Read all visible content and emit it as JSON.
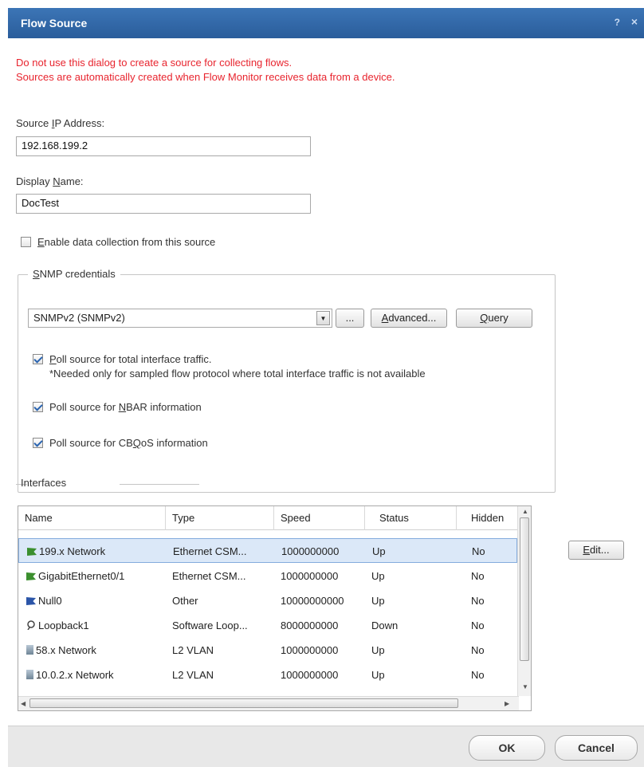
{
  "dialog": {
    "title": "Flow Source",
    "help_glyph": "?",
    "close_glyph": "×"
  },
  "warning": {
    "line1": "Do not use this dialog to create a source for collecting flows.",
    "line2": "Sources are automatically created when Flow Monitor receives data from a device."
  },
  "source_ip": {
    "label_pre": "Source ",
    "label_key": "I",
    "label_post": "P Address:",
    "value": "192.168.199.2"
  },
  "display_name": {
    "label_pre": "Display ",
    "label_key": "N",
    "label_post": "ame:",
    "value": "DocTest"
  },
  "enable_collection": {
    "key": "E",
    "rest": "nable data collection from this source",
    "checked": false
  },
  "snmp": {
    "legend_key": "S",
    "legend_rest": "NMP credentials",
    "selected": "SNMPv2 (SNMPv2)",
    "ellipsis_label": "...",
    "advanced_key": "A",
    "advanced_rest": "dvanced...",
    "query_key": "Q",
    "query_rest": "uery",
    "poll_total_key": "P",
    "poll_total_rest": "oll source for total interface traffic.",
    "poll_total_note": "*Needed only for sampled flow protocol where total interface traffic is not available",
    "poll_nbar_pre": "Poll source for ",
    "poll_nbar_key": "N",
    "poll_nbar_post": "BAR information",
    "poll_cbqos_pre": "Poll source for CB",
    "poll_cbqos_key": "Q",
    "poll_cbqos_post": "oS information"
  },
  "interfaces": {
    "legend": "Interfaces",
    "columns": [
      "Name",
      "Type",
      "Speed",
      "Status",
      "Hidden"
    ],
    "rows": [
      {
        "icon": "flag-green",
        "name": "199.x Network",
        "type": "Ethernet CSM...",
        "speed": "1000000000",
        "status": "Up",
        "hidden": "No",
        "selected": true
      },
      {
        "icon": "flag-green",
        "name": "GigabitEthernet0/1",
        "type": "Ethernet CSM...",
        "speed": "1000000000",
        "status": "Up",
        "hidden": "No"
      },
      {
        "icon": "flag-blue",
        "name": "Null0",
        "type": "Other",
        "speed": "10000000000",
        "status": "Up",
        "hidden": "No"
      },
      {
        "icon": "loopback",
        "name": "Loopback1",
        "type": "Software Loop...",
        "speed": "8000000000",
        "status": "Down",
        "hidden": "No"
      },
      {
        "icon": "vlan",
        "name": "58.x Network",
        "type": "L2 VLAN",
        "speed": "1000000000",
        "status": "Up",
        "hidden": "No"
      },
      {
        "icon": "vlan",
        "name": "10.0.2.x Network",
        "type": "L2 VLAN",
        "speed": "1000000000",
        "status": "Up",
        "hidden": "No"
      }
    ],
    "edit_key": "E",
    "edit_rest": "dit..."
  },
  "footer": {
    "ok": "OK",
    "cancel": "Cancel"
  }
}
